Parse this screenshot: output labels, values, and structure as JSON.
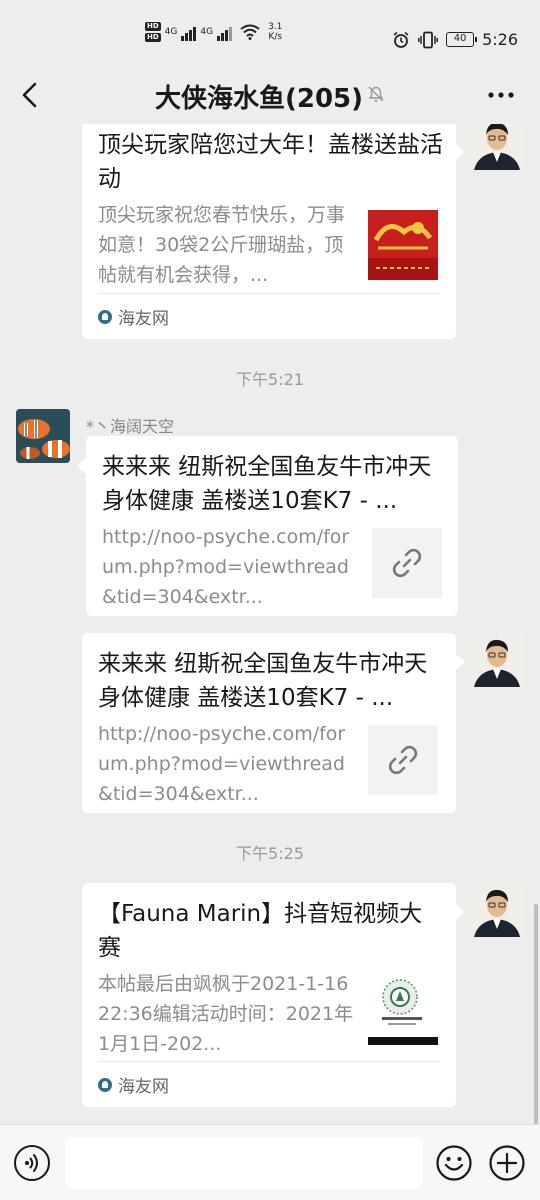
{
  "status_bar": {
    "hd1": "HD",
    "hd2": "HD",
    "net1": "4G",
    "net2": "4G",
    "speed_value": "3.1",
    "speed_unit": "K/s",
    "battery": "40",
    "time": "5:26"
  },
  "header": {
    "title": "大侠海水鱼(205)"
  },
  "messages": [
    {
      "title": "顶尖玩家陪您过大年！盖楼送盐活动",
      "description": "顶尖玩家祝您春节快乐，万事如意！30袋2公斤珊瑚盐，顶帖就有机会获得，...",
      "source": "海友网"
    },
    {
      "timestamp": "下午5:21"
    },
    {
      "sender": "*丶海阔天空",
      "title": "来来来 纽斯祝全国鱼友牛市冲天 身体健康 盖楼送10套K7 - ...",
      "description": "http://noo-psyche.com/forum.php?mod=viewthread&tid=304&extr..."
    },
    {
      "title": "来来来 纽斯祝全国鱼友牛市冲天 身体健康 盖楼送10套K7 - ...",
      "description": "http://noo-psyche.com/forum.php?mod=viewthread&tid=304&extr..."
    },
    {
      "timestamp": "下午5:25"
    },
    {
      "title": "【Fauna Marin】抖音短视频大赛",
      "description": "本帖最后由飒枫于2021-1-1622:36编辑活动时间：2021年1月1日-202...",
      "source": "海友网"
    }
  ],
  "input": {
    "placeholder": ""
  },
  "colors": {
    "background": "#ededed",
    "card": "#ffffff",
    "secondary_text": "#8c8c8c",
    "timestamp": "#999999"
  }
}
